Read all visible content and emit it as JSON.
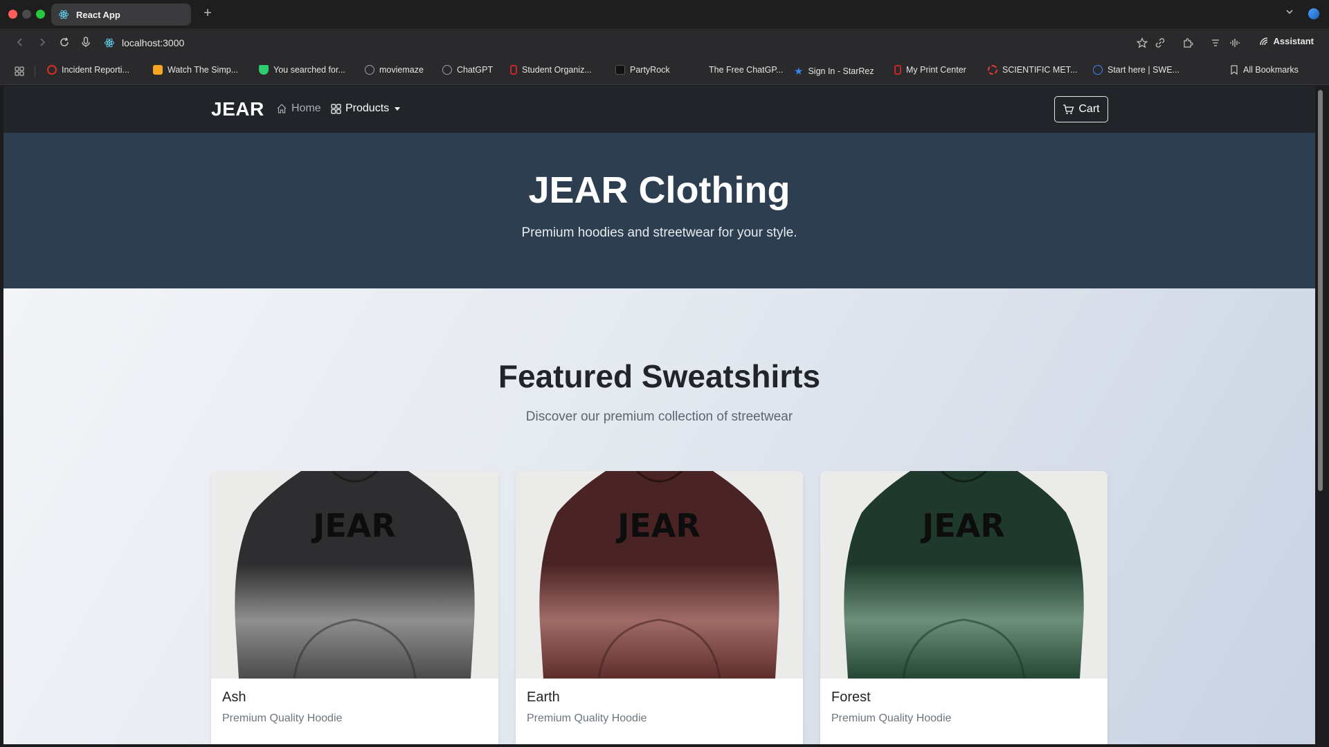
{
  "browser": {
    "tab_title": "React App",
    "new_tab_label": "+",
    "url": "localhost:3000",
    "assistant_label": "Assistant",
    "bookmarks": [
      {
        "label": "Incident Reporti...",
        "color": "#d93025"
      },
      {
        "label": "Watch The Simp...",
        "color": "#f5a623"
      },
      {
        "label": "You searched for...",
        "color": "#2ecc71"
      },
      {
        "label": "moviemaze",
        "color": "#9aa0a6"
      },
      {
        "label": "ChatGPT",
        "color": "#9aa0a6"
      },
      {
        "label": "Student Organiz...",
        "color": "#c62828"
      },
      {
        "label": "PartyRock",
        "color": "#111111"
      },
      {
        "label": "The Free ChatGP...",
        "color": "#2a2a2c"
      },
      {
        "label": "Sign In - StarRez",
        "color": "#3b82f6"
      },
      {
        "label": "My Print Center",
        "color": "#c62828"
      },
      {
        "label": "SCIENTIFIC MET...",
        "color": "#e53935"
      },
      {
        "label": "Start here | SWE...",
        "color": "#4285f4"
      }
    ],
    "all_bookmarks_label": "All Bookmarks"
  },
  "app": {
    "brand": "JEAR",
    "nav": {
      "home": "Home",
      "products": "Products",
      "cart": "Cart"
    },
    "hero": {
      "title": "JEAR Clothing",
      "subtitle": "Premium hoodies and streetwear for your style."
    },
    "featured": {
      "title": "Featured Sweatshirts",
      "subtitle": "Discover our premium collection of streetwear"
    },
    "products": [
      {
        "name": "Ash",
        "description": "Premium Quality Hoodie",
        "logo_text": "JEAR",
        "color_top": "#2e2e30",
        "color_bottom": "#4a4a4c"
      },
      {
        "name": "Earth",
        "description": "Premium Quality Hoodie",
        "logo_text": "JEAR",
        "color_top": "#4a2424",
        "color_bottom": "#5e2e2c"
      },
      {
        "name": "Forest",
        "description": "Premium Quality Hoodie",
        "logo_text": "JEAR",
        "color_top": "#1f3a2c",
        "color_bottom": "#244634"
      }
    ]
  },
  "colors": {
    "navbar": "#212529",
    "hero": "#2c3e50"
  }
}
